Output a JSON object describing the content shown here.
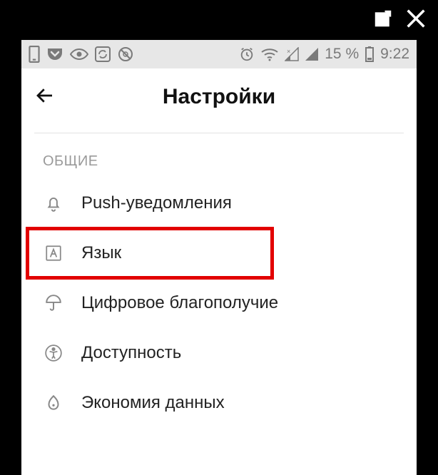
{
  "overlay": {
    "open_external_icon": "open-external",
    "close_icon": "close"
  },
  "status_bar": {
    "battery_text": "15 %",
    "clock": "9:22"
  },
  "header": {
    "title": "Настройки"
  },
  "section": {
    "label": "ОБЩИЕ",
    "items": [
      {
        "icon": "bell",
        "label": "Push-уведомления",
        "highlighted": false
      },
      {
        "icon": "language",
        "label": "Язык",
        "highlighted": true
      },
      {
        "icon": "umbrella",
        "label": "Цифровое благополучие",
        "highlighted": false
      },
      {
        "icon": "accessibility",
        "label": "Доступность",
        "highlighted": false
      },
      {
        "icon": "data-saver",
        "label": "Экономия данных",
        "highlighted": false
      }
    ]
  }
}
